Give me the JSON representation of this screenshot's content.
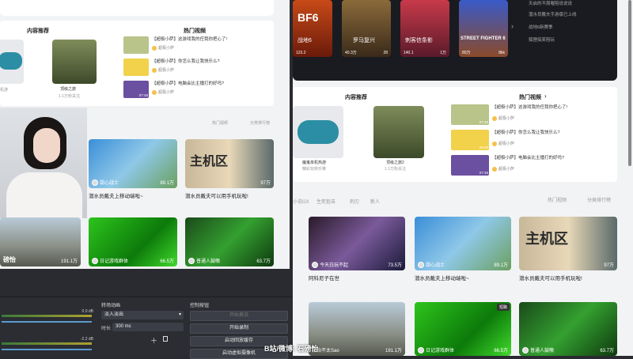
{
  "left_window": {
    "recommend_title": "内容推荐",
    "hot_title": "热门视频",
    "recommend_items": [
      {
        "name": "机游",
        "sub": "游戏"
      },
      {
        "name": "顶级之旅",
        "sub": "1.1万粉关注"
      }
    ],
    "hot_videos": [
      {
        "title": "【超极小萨】这游戏我的任我你把心了!",
        "uploader": "超极小萨",
        "duration": "07:48"
      },
      {
        "title": "【超极小萨】你怎么我让我快乐么?",
        "uploader": "超极小萨",
        "duration": "08:33"
      },
      {
        "title": "【超极小萨】电脑会比主播打的好吗?",
        "uploader": "超极小萨",
        "duration": "07:48"
      }
    ],
    "tab_hot": "热门视频",
    "tab_rank": "分类排行榜",
    "big_cards": [
      {
        "stat": "89.1万",
        "uploader": "甜心战士",
        "caption": "潜水员戴夫上移动端啦~"
      },
      {
        "stat": "97万",
        "uploader": "",
        "banner": "主机区",
        "caption": "潜水员戴夫可以用手机玩啦!"
      },
      {
        "stat": "191.1万",
        "uploader": "磅怡",
        "caption": ""
      },
      {
        "stat": "66.5万",
        "uploader": "日记游戏群体",
        "caption": ""
      },
      {
        "stat": "63.7万",
        "uploader": "普通人鼓嗷",
        "caption": ""
      }
    ]
  },
  "obs": {
    "mixer_value_1": "0.0 dB",
    "mixer_value_2": "-2.2 dB",
    "scale": [
      "-60",
      "-55",
      "-50",
      "-45",
      "-40",
      "-35",
      "-30",
      "-25",
      "-20",
      "-15",
      "-10",
      "-5",
      "0"
    ],
    "transition_title": "转场动画",
    "transition_value": "淡入淡出",
    "duration_label": "时长",
    "duration_value": "300 ms",
    "controls_title": "控制按钮",
    "controls": [
      "开始推流",
      "开始录制",
      "启动回放缓存",
      "启动虚拟摄像机"
    ]
  },
  "right_window": {
    "games": [
      {
        "badge": "BF6",
        "label": "战地6",
        "count": "123.2"
      },
      {
        "label": "罗马复兴",
        "count": "40.3万",
        "count2": "28"
      },
      {
        "label": "刺客信条影",
        "count": "140.1",
        "count2": "1万"
      },
      {
        "label": "STREET FIGHTER 6",
        "count": "80万",
        "count2": "8kk"
      }
    ],
    "side_list": [
      "天启的不周喔陪说说说",
      "潜水员戴夫手游版已上线",
      "战地6新赛季",
      "狐狸搞笑陪玩"
    ],
    "recommend_title": "内容推荐",
    "hot_title": "热门视频",
    "recommend_items": [
      {
        "name": "魔鬼单机热游",
        "sub": "精彩玩转乐推"
      },
      {
        "name": "顶级之旅2",
        "sub": "1.1万粉关注"
      }
    ],
    "hot_videos": [
      {
        "title": "【超极小萨】这游戏我的任我你把心了!",
        "uploader": "超极小萨",
        "duration": "07:48"
      },
      {
        "title": "【超极小萨】你怎么我让我快乐么?",
        "uploader": "超极小萨",
        "duration": "08:33"
      },
      {
        "title": "【超极小萨】电脑会比主播打的好吗?",
        "uploader": "超极小萨",
        "duration": "07:48"
      }
    ],
    "tabs": [
      "小说GX",
      "生死狙击",
      "刺刃",
      "新人"
    ],
    "tab_hot": "热门视频",
    "tab_rank": "分类排行榜",
    "big_cards": [
      {
        "stat": "73.5万",
        "uploader": "今天白玩不起",
        "caption": "阿科尼子在世"
      },
      {
        "stat": "89.1万",
        "uploader": "甜心战士",
        "caption": "潜水员戴夫上移动端啦~"
      },
      {
        "stat": "97万",
        "banner": "主机区",
        "caption": "潜水员戴夫可以用手机玩啦!"
      },
      {
        "stat": "191.1万",
        "uploader": "磅怡不太Sao",
        "caption": ""
      },
      {
        "stat": "66.5万",
        "uploader": "日记游戏群体",
        "caption": ""
      },
      {
        "stat": "63.7万",
        "uploader": "普通人鼓嗷",
        "caption": ""
      }
    ],
    "badge_text": "短路"
  },
  "watermark": "B站/微博: 石磅怡"
}
